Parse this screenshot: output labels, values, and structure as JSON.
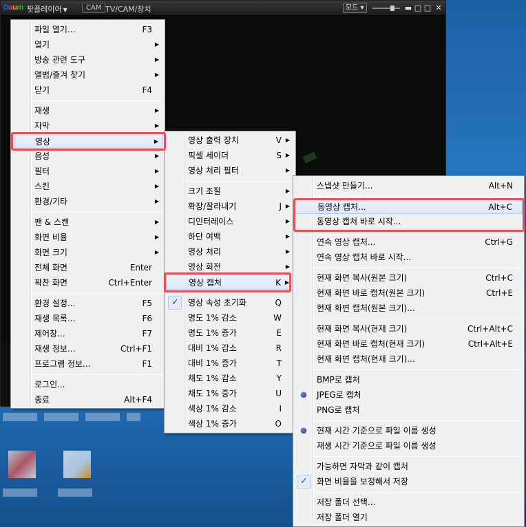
{
  "titlebar": {
    "app_name": "팟플레이어",
    "cam_badge": "CAM",
    "cam_label": "TV/CAM/장치",
    "mode_button": "모드",
    "icons": [
      "minimize-icon",
      "restore-icon",
      "maximize-icon",
      "close-icon"
    ],
    "icon_glyphs": [
      "▬",
      "□",
      "□",
      "✕"
    ]
  },
  "main_menu": [
    {
      "label": "파일 열기...",
      "shortcut": "F3"
    },
    {
      "label": "열기",
      "submenu": true
    },
    {
      "label": "방송 관련 도구",
      "submenu": true
    },
    {
      "label": "앨범/즐겨 찾기",
      "submenu": true
    },
    {
      "label": "닫기",
      "shortcut": "F4"
    },
    {
      "label": "재생",
      "submenu": true
    },
    {
      "label": "자막",
      "submenu": true
    },
    {
      "label": "영상",
      "submenu": true,
      "highlighted": true
    },
    {
      "label": "음성",
      "submenu": true
    },
    {
      "label": "필터",
      "submenu": true
    },
    {
      "label": "스킨",
      "submenu": true
    },
    {
      "label": "환경/기타",
      "submenu": true
    },
    {
      "label": "팬 & 스캔",
      "submenu": true
    },
    {
      "label": "화면 비율",
      "submenu": true
    },
    {
      "label": "화면 크기",
      "submenu": true
    },
    {
      "label": "전체 화면",
      "shortcut": "Enter"
    },
    {
      "label": "꽉찬 화면",
      "shortcut": "Ctrl+Enter"
    },
    {
      "label": "환경 설정...",
      "shortcut": "F5"
    },
    {
      "label": "재생 목록...",
      "shortcut": "F6"
    },
    {
      "label": "제어창...",
      "shortcut": "F7"
    },
    {
      "label": "재생 정보...",
      "shortcut": "Ctrl+F1"
    },
    {
      "label": "프로그램 정보...",
      "shortcut": "F1"
    },
    {
      "label": "로그인..."
    },
    {
      "label": "종료",
      "shortcut": "Alt+F4"
    }
  ],
  "video_menu": [
    {
      "label": "영상 출력 장치",
      "shortcut": "V",
      "submenu": true
    },
    {
      "label": "픽셀 세이더",
      "shortcut": "S",
      "submenu": true
    },
    {
      "label": "영상 처리 필터",
      "submenu": true
    },
    {
      "label": "크기 조절",
      "submenu": true
    },
    {
      "label": "확장/잘라내기",
      "shortcut": "J",
      "submenu": true
    },
    {
      "label": "디인터레이스",
      "submenu": true
    },
    {
      "label": "하단 여백",
      "submenu": true
    },
    {
      "label": "영상 처리",
      "submenu": true
    },
    {
      "label": "영상 회전",
      "submenu": true
    },
    {
      "label": "영상 캡처",
      "shortcut": "K",
      "submenu": true,
      "highlighted": true
    },
    {
      "label": "영상 속성 초기화",
      "shortcut": "Q",
      "checked": true
    },
    {
      "label": "명도 1% 감소",
      "shortcut": "W"
    },
    {
      "label": "명도 1% 증가",
      "shortcut": "E"
    },
    {
      "label": "대비 1% 감소",
      "shortcut": "R"
    },
    {
      "label": "대비 1% 증가",
      "shortcut": "T"
    },
    {
      "label": "채도 1% 감소",
      "shortcut": "Y"
    },
    {
      "label": "채도 1% 증가",
      "shortcut": "U"
    },
    {
      "label": "색상 1% 감소",
      "shortcut": "I"
    },
    {
      "label": "색상 1% 증가",
      "shortcut": "O"
    }
  ],
  "capture_menu": [
    {
      "label": "스냅샷 만들기...",
      "shortcut": "Alt+N"
    },
    {
      "label": "동영상 캡처...",
      "shortcut": "Alt+C",
      "highlighted": true
    },
    {
      "label": "동영상 캡처 바로 시작..."
    },
    {
      "label": "연속 영상 캡처...",
      "shortcut": "Ctrl+G"
    },
    {
      "label": "연속 영상 캡처 바로 시작..."
    },
    {
      "label": "현재 화면 복사(원본 크기)",
      "shortcut": "Ctrl+C"
    },
    {
      "label": "현재 화면 바로 캡처(원본 크기)",
      "shortcut": "Ctrl+E"
    },
    {
      "label": "현재 화면 캡처(원본 크기)..."
    },
    {
      "label": "현재 화면 복사(현재 크기)",
      "shortcut": "Ctrl+Alt+C"
    },
    {
      "label": "현재 화면 바로 캡처(현재 크기)",
      "shortcut": "Ctrl+Alt+E"
    },
    {
      "label": "현재 화면 캡처(현재 크기)..."
    },
    {
      "label": "BMP로 캡처"
    },
    {
      "label": "JPEG로 캡처",
      "radio": true
    },
    {
      "label": "PNG로 캡처"
    },
    {
      "label": "현재 시간 기준으로 파일 이름 생성",
      "radio": true
    },
    {
      "label": "재생 시간 기준으로 파일 이름 생성"
    },
    {
      "label": "가능하면 자막과 같이 캡처"
    },
    {
      "label": "화면 비율을 보정해서 저장",
      "checked": true
    },
    {
      "label": "저장 폴더 선택..."
    },
    {
      "label": "저장 폴더 열기"
    }
  ],
  "colors": {
    "highlight_border": "#e8505b",
    "menu_bg": "#f0f0f0",
    "desktop": "#2a7fc7"
  }
}
